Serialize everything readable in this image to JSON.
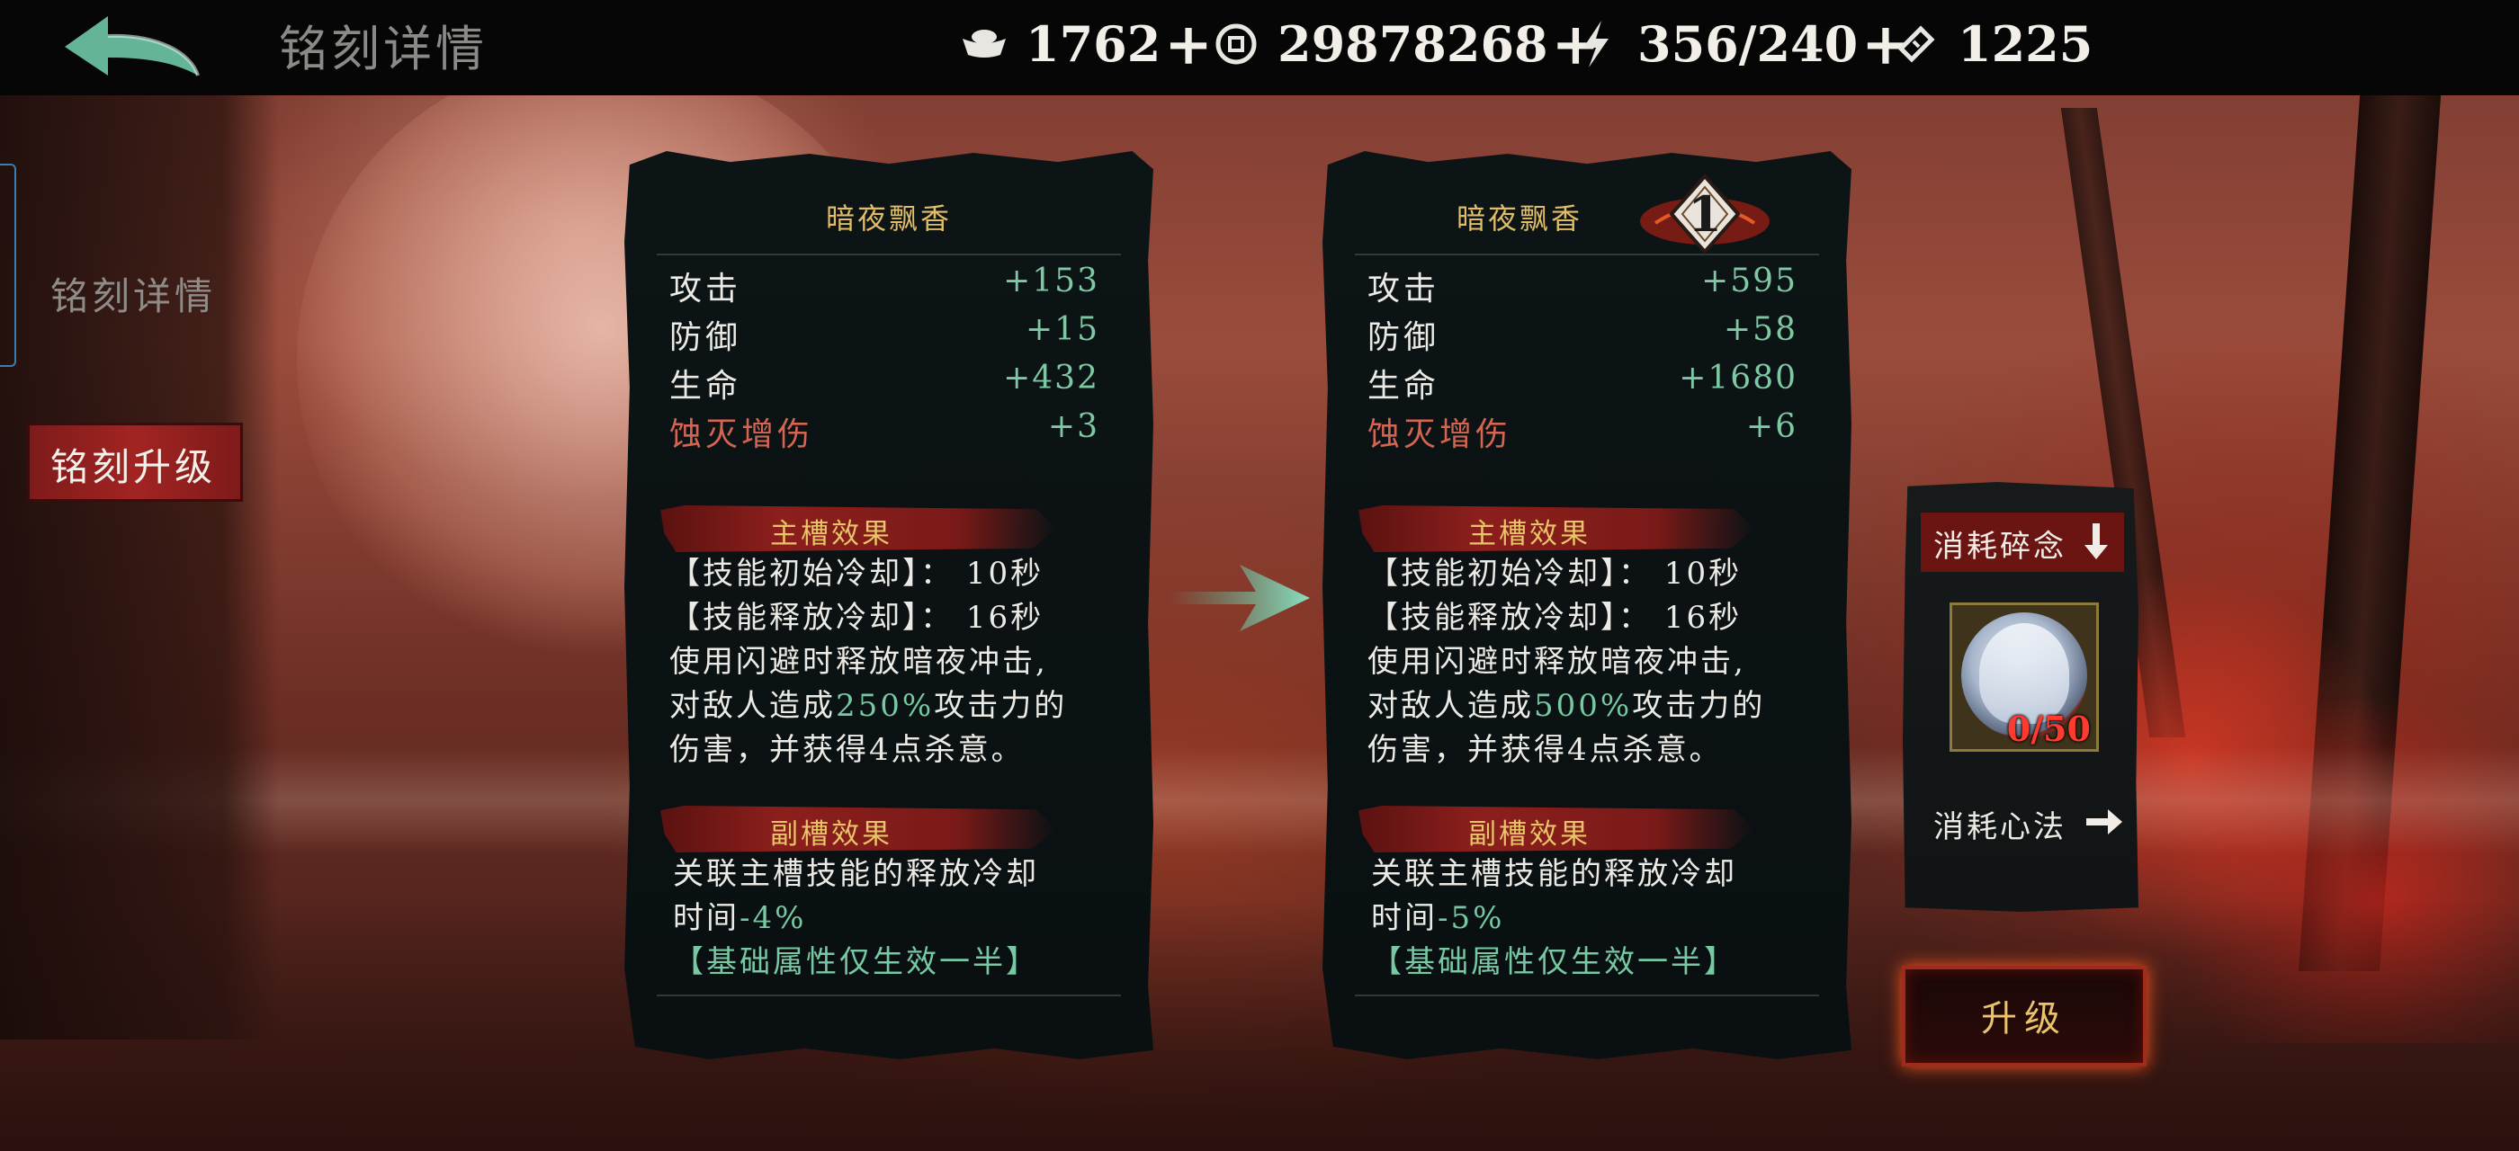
{
  "header": {
    "title": "铭刻详情",
    "resources": [
      {
        "icon": "silver-ingot-icon",
        "value": "1762",
        "has_plus": true
      },
      {
        "icon": "coin-icon",
        "value": "29878268",
        "has_plus": true
      },
      {
        "icon": "lightning-icon",
        "value": "356/240",
        "has_plus": true
      },
      {
        "icon": "ticket-icon",
        "value": "1225",
        "has_plus": false
      }
    ],
    "plus_symbol": "+"
  },
  "sidebar": {
    "items": [
      {
        "label": "铭刻详情",
        "selected": false
      },
      {
        "label": "铭刻升级",
        "selected": true
      }
    ]
  },
  "current": {
    "name": "暗夜飘香",
    "stats": [
      {
        "label": "攻击",
        "value": "+153"
      },
      {
        "label": "防御",
        "value": "+15"
      },
      {
        "label": "生命",
        "value": "+432"
      },
      {
        "label": "蚀灭增伤",
        "value": "+3",
        "highlight": true
      }
    ],
    "main_title": "主槽效果",
    "main_lines": [
      "【技能初始冷却】： 10秒",
      "【技能释放冷却】： 16秒",
      "使用闪避时释放暗夜冲击,"
    ],
    "main_pre": "对敌人造成",
    "main_pct": "250%",
    "main_post": "攻击力的",
    "main_last": "伤害，并获得4点杀意。",
    "sub_title": "副槽效果",
    "sub_line1": "关联主槽技能的释放冷却",
    "sub_time": "时间",
    "sub_value": "-4%",
    "note": "【基础属性仅生效一半】"
  },
  "upgraded": {
    "name": "暗夜飘香",
    "rank": "1",
    "stats": [
      {
        "label": "攻击",
        "value": "+595"
      },
      {
        "label": "防御",
        "value": "+58"
      },
      {
        "label": "生命",
        "value": "+1680"
      },
      {
        "label": "蚀灭增伤",
        "value": "+6",
        "highlight": true
      }
    ],
    "main_title": "主槽效果",
    "main_lines": [
      "【技能初始冷却】： 10秒",
      "【技能释放冷却】： 16秒",
      "使用闪避时释放暗夜冲击,"
    ],
    "main_pre": "对敌人造成",
    "main_pct": "500%",
    "main_post": "攻击力的",
    "main_last": "伤害，并获得4点杀意。",
    "sub_title": "副槽效果",
    "sub_line1": "关联主槽技能的释放冷却",
    "sub_time": "时间",
    "sub_value": "-5%",
    "note": "【基础属性仅生效一半】"
  },
  "cost": {
    "fragment_label": "消耗碎念",
    "fragment_count": "0/50",
    "method_label": "消耗心法"
  },
  "upgrade_button": "升级",
  "colors": {
    "accent_gold": "#e0bd66",
    "stat_green": "#7ec9a4",
    "stat_red": "#d36552",
    "ribbon_red": "#8c1f1c"
  }
}
